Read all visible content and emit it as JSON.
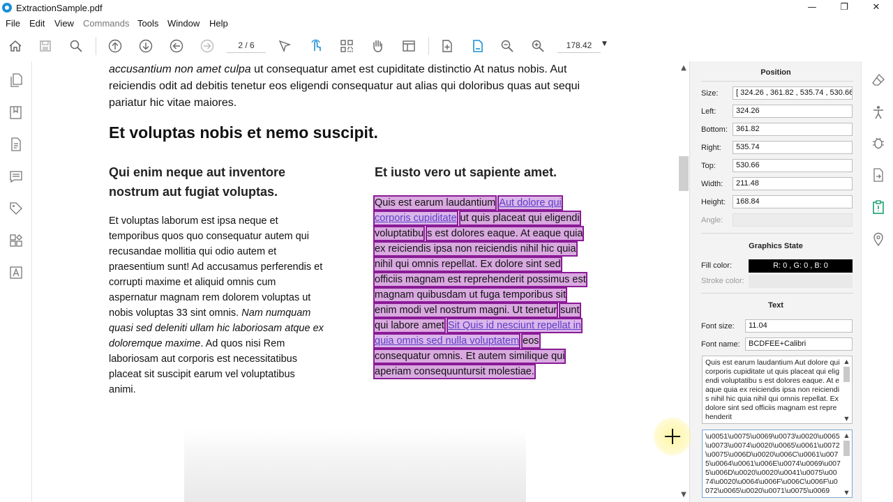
{
  "window": {
    "title": "ExtractionSample.pdf",
    "minimize_glyph": "—",
    "restore_glyph": "❐",
    "close_glyph": "✕"
  },
  "menu": [
    "File",
    "Edit",
    "View",
    "Commands",
    "Tools",
    "Window",
    "Help"
  ],
  "toolbar": {
    "page_value": "2 / 6",
    "zoom_value": "178.42",
    "icons": [
      "home-icon",
      "save-icon",
      "search-icon",
      "page-up-icon",
      "page-down-icon",
      "back-icon",
      "forward-icon",
      "select-arrow-icon",
      "touch-select-icon",
      "marquee-icon",
      "pan-hand-icon",
      "table-icon",
      "insert-page-icon",
      "extract-page-icon",
      "zoom-out-icon",
      "zoom-in-icon"
    ]
  },
  "document": {
    "para1_line1_italic": "accusantium non amet culpa",
    "para1_line1_rest": " ut consequatur amet est cupiditate distinctio At natus nobis. Aut",
    "para1_line2": "reiciendis odit ad debitis tenetur eos eligendi consequatur aut alias qui doloribus quas aut sequi",
    "para1_line3": "pariatur hic vitae maiores.",
    "heading": "Et voluptas nobis et nemo suscipit.",
    "left_subheading_1": "Qui enim neque aut inventore",
    "left_subheading_2": "nostrum aut fugiat voluptas.",
    "right_subheading": "Et iusto vero ut sapiente amet.",
    "left_body": [
      {
        "text": "Et voluptas laborum est ipsa neque et"
      },
      {
        "text": "temporibus quos quo consequatur autem qui"
      },
      {
        "text": "recusandae mollitia qui odio autem et"
      },
      {
        "text": "praesentium sunt! Ad accusamus perferendis et"
      },
      {
        "text": "corrupti maxime et aliquid omnis cum"
      },
      {
        "text": "aspernatur magnam rem dolorem voluptas ut"
      },
      {
        "text": "nobis voluptas 33 sint omnis. ",
        "italic": "Nam numquam"
      },
      {
        "italic_full": "quasi sed deleniti ullam hic laboriosam atque ex"
      },
      {
        "italic": "doloremque maxime",
        "text": ". Ad quos nisi Rem"
      },
      {
        "text": "laboriosam aut corporis est necessitatibus"
      },
      {
        "text": "placeat sit suscipit earum vel voluptatibus"
      },
      {
        "text": "animi."
      }
    ],
    "right_body": [
      [
        {
          "t": "Quis est earum laudantium"
        },
        {
          "t": "Aut dolore qui",
          "link": true
        }
      ],
      [
        {
          "t": "corporis cupiditate",
          "link": true
        },
        {
          "t": "ut quis placeat qui eligendi"
        }
      ],
      [
        {
          "t": "voluptatibu"
        },
        {
          "t": "s est dolores eaque. At eaque quia"
        }
      ],
      [
        {
          "t": "ex reiciendis ipsa non reiciendis nihil hic quia"
        }
      ],
      [
        {
          "t": "nihil qui omnis repellat. Ex dolore sint sed"
        }
      ],
      [
        {
          "t": "officiis magnam est reprehenderit possimus est"
        }
      ],
      [
        {
          "t": "magnam quibusdam ut fuga temporibus sit"
        }
      ],
      [
        {
          "t": "enim modi vel nostrum magni. Ut tenetur"
        },
        {
          "t": "sunt"
        }
      ],
      [
        {
          "t": "qui labore amet"
        },
        {
          "t": "Sit Quis id nesciunt repellat in",
          "link": true
        }
      ],
      [
        {
          "t": "quia omnis sed nulla voluptatem",
          "link": true
        },
        {
          "t": "eos"
        }
      ],
      [
        {
          "t": "consequatur omnis. Et autem similique qui"
        }
      ],
      [
        {
          "t": "aperiam consequuntursit molestiae."
        }
      ]
    ]
  },
  "panel": {
    "position_title": "Position",
    "size_label": "Size:",
    "size_value": "[ 324.26 , 361.82 , 535.74 , 530.66 ]",
    "left_label": "Left:",
    "left_value": "324.26",
    "bottom_label": "Bottom:",
    "bottom_value": "361.82",
    "right_label": "Right:",
    "right_value": "535.74",
    "top_label": "Top:",
    "top_value": "530.66",
    "width_label": "Width:",
    "width_value": "211.48",
    "height_label": "Height:",
    "height_value": "168.84",
    "angle_label": "Angle:",
    "angle_value": "",
    "graphics_title": "Graphics State",
    "fill_label": "Fill color:",
    "fill_value": "R: 0 , G: 0 , B: 0",
    "fill_color": "#000000",
    "stroke_label": "Stroke color:",
    "text_title": "Text",
    "fontsize_label": "Font size:",
    "fontsize_value": "11.04",
    "fontname_label": "Font name:",
    "fontname_value": "BCDFEE+Calibri",
    "text_content": "Quis est earum laudantium  Aut dolore qui  corporis cupiditate   ut quis placeat qui eligendi  voluptatibu s est dolores eaque. At eaque quia  ex reiciendis ipsa non reiciendis nihil hic quia  nihil qui omnis repellat. Ex dolore sint sed officiis magnam est reprehenderit",
    "unicode_content": "\\u0051\\u0075\\u0069\\u0073\\u0020\\u0065\\u0073\\u0074\\u0020\\u0065\\u0061\\u0072\\u0075\\u006D\\u0020\\u006C\\u0061\\u0075\\u0064\\u0061\\u006E\\u0074\\u0069\\u0075\\u006D\\u0020\\u0020\\u0041\\u0075\\u0074\\u0020\\u0064\\u006F\\u006C\\u006F\\u0072\\u0065\\u0020\\u0071\\u0075\\u0069"
  },
  "colors": {
    "selection_fill": "#d9a9e0",
    "selection_border": "#8a1b96",
    "link_text": "#5b3ec8",
    "accent": "#1b8fd6",
    "right_sidebar_active": "#1aa06d"
  }
}
